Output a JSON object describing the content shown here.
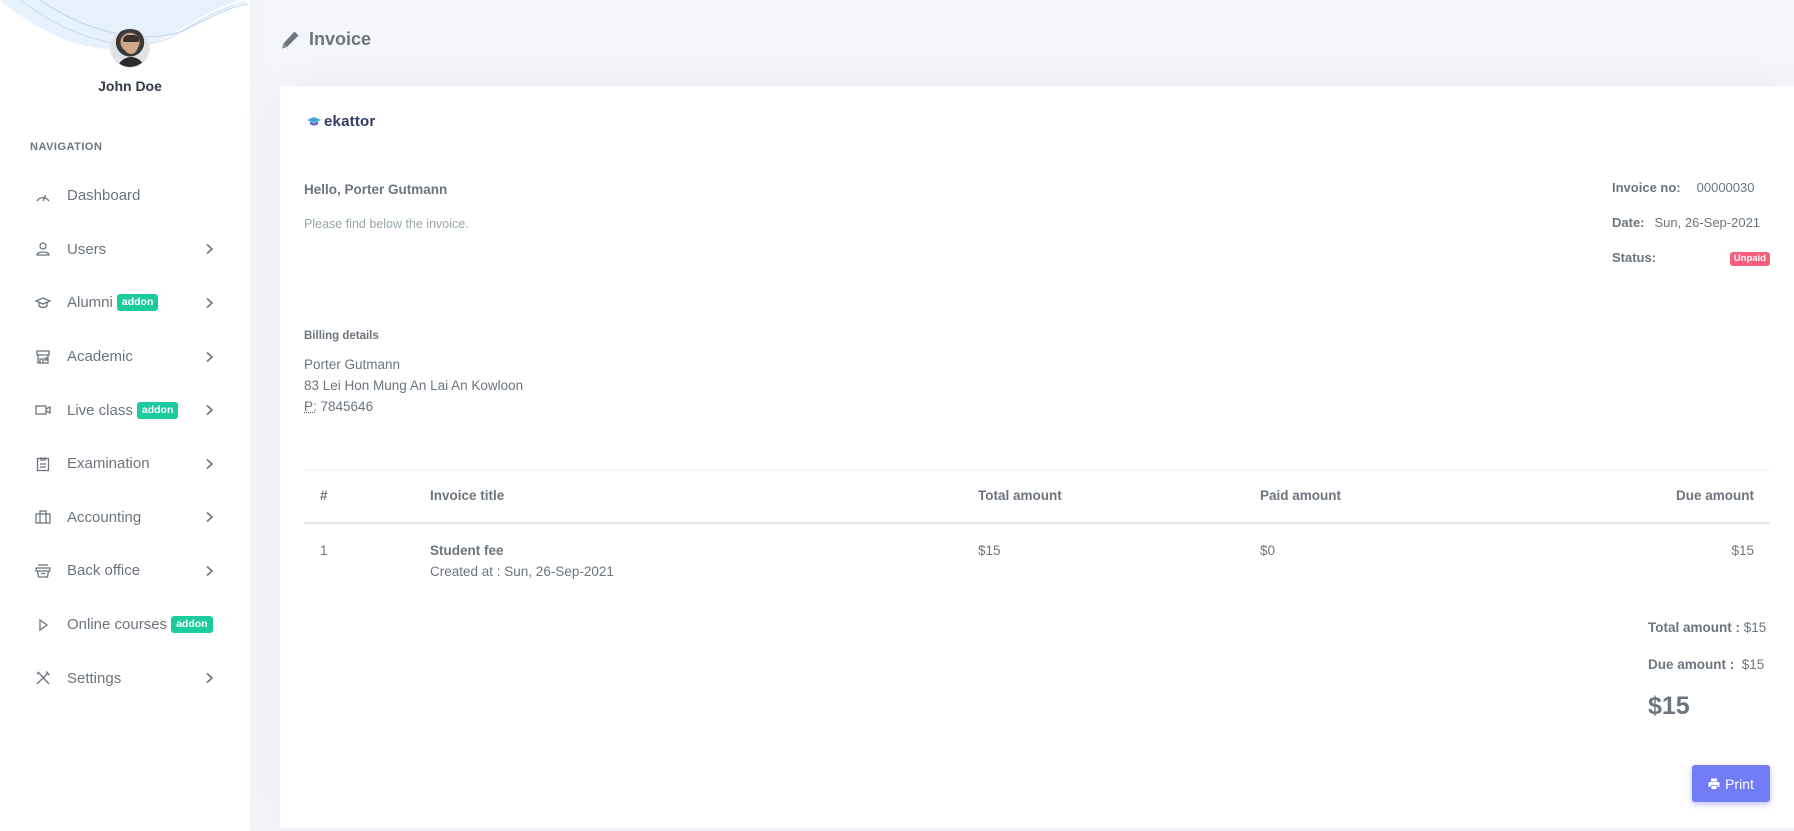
{
  "sidebar": {
    "user_name": "John Doe",
    "nav_title": "NAVIGATION",
    "items": [
      {
        "label": "Dashboard",
        "icon": "dashboard-icon",
        "addon": null,
        "has_children": false
      },
      {
        "label": "Users",
        "icon": "user-icon",
        "addon": null,
        "has_children": true
      },
      {
        "label": "Alumni",
        "icon": "graduation-cap-icon",
        "addon": "addon",
        "has_children": true
      },
      {
        "label": "Academic",
        "icon": "store-icon",
        "addon": null,
        "has_children": true
      },
      {
        "label": "Live class",
        "icon": "video-icon",
        "addon": "addon",
        "has_children": true
      },
      {
        "label": "Examination",
        "icon": "clipboard-icon",
        "addon": null,
        "has_children": true
      },
      {
        "label": "Accounting",
        "icon": "briefcase-icon",
        "addon": null,
        "has_children": true
      },
      {
        "label": "Back office",
        "icon": "inbox-icon",
        "addon": null,
        "has_children": true
      },
      {
        "label": "Online courses",
        "icon": "play-icon",
        "addon": "addon",
        "has_children": false
      },
      {
        "label": "Settings",
        "icon": "tools-icon",
        "addon": null,
        "has_children": true
      }
    ]
  },
  "page": {
    "title": "Invoice",
    "title_icon": "pencil-icon"
  },
  "invoice": {
    "logo_text": "ekattor",
    "greeting": "Hello, Porter Gutmann",
    "sub_text": "Please find below the invoice.",
    "meta": {
      "invoice_no_label": "Invoice no:",
      "invoice_no": "00000030",
      "date_label": "Date:",
      "date": "Sun, 26-Sep-2021",
      "status_label": "Status:",
      "status": "Unpaid",
      "status_color": "#fa5c7c"
    },
    "billing": {
      "title": "Billing details",
      "name": "Porter Gutmann",
      "address": "83 Lei Hon Mung An Lai An Kowloon",
      "phone_label": "P:",
      "phone": " 7845646"
    },
    "table": {
      "headers": [
        "#",
        "Invoice title",
        "Total amount",
        "Paid amount",
        "Due amount"
      ],
      "rows": [
        {
          "num": "1",
          "title": "Student fee",
          "created": "Created at : Sun, 26-Sep-2021",
          "total": "$15",
          "paid": "$0",
          "due": "$15"
        }
      ]
    },
    "totals": {
      "total_label": "Total amount :",
      "total_value": " $15",
      "due_label": "Due amount :",
      "due_value": "  $15",
      "grand": "$15"
    },
    "print_label": "Print"
  },
  "colors": {
    "accent": "#727cf5",
    "addon_badge": "#1ccb9e",
    "status_unpaid": "#fa5c7c"
  }
}
